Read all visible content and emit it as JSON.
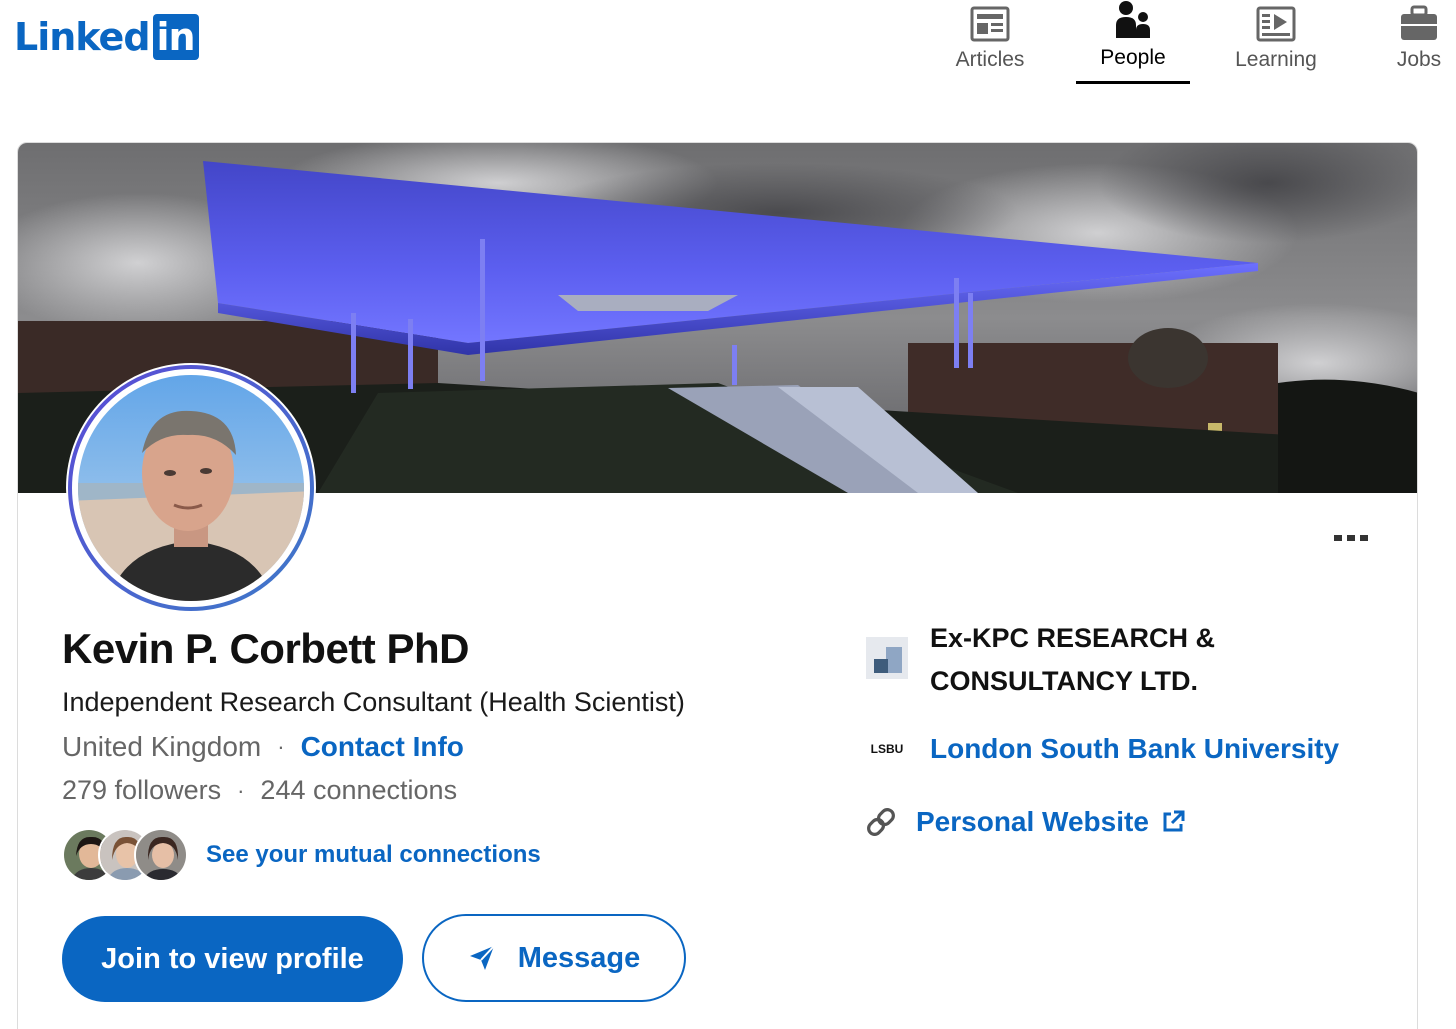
{
  "header": {
    "logo_text": "Linked",
    "logo_box": "in",
    "nav": [
      {
        "label": "Articles",
        "icon": "articles-icon"
      },
      {
        "label": "People",
        "icon": "people-icon",
        "active": true
      },
      {
        "label": "Learning",
        "icon": "learning-icon"
      },
      {
        "label": "Jobs",
        "icon": "briefcase-icon"
      }
    ]
  },
  "profile": {
    "name": "Kevin P. Corbett PhD",
    "headline": "Independent Research Consultant (Health Scientist)",
    "location": "United Kingdom",
    "separator": "·",
    "contact_label": "Contact Info",
    "followers": "279 followers",
    "connections": "244 connections",
    "mutual_label": "See your mutual connections",
    "join_label": "Join to view profile",
    "message_label": "Message"
  },
  "sidebar": {
    "experience": "Ex-KPC RESEARCH & CONSULTANCY LTD.",
    "education": "London South Bank University",
    "education_logo_text": "LSBU",
    "website_label": "Personal Website"
  },
  "colors": {
    "brand": "#0a66c2",
    "muted_text": "#666666",
    "cover_glow": "#5a5cf0"
  }
}
